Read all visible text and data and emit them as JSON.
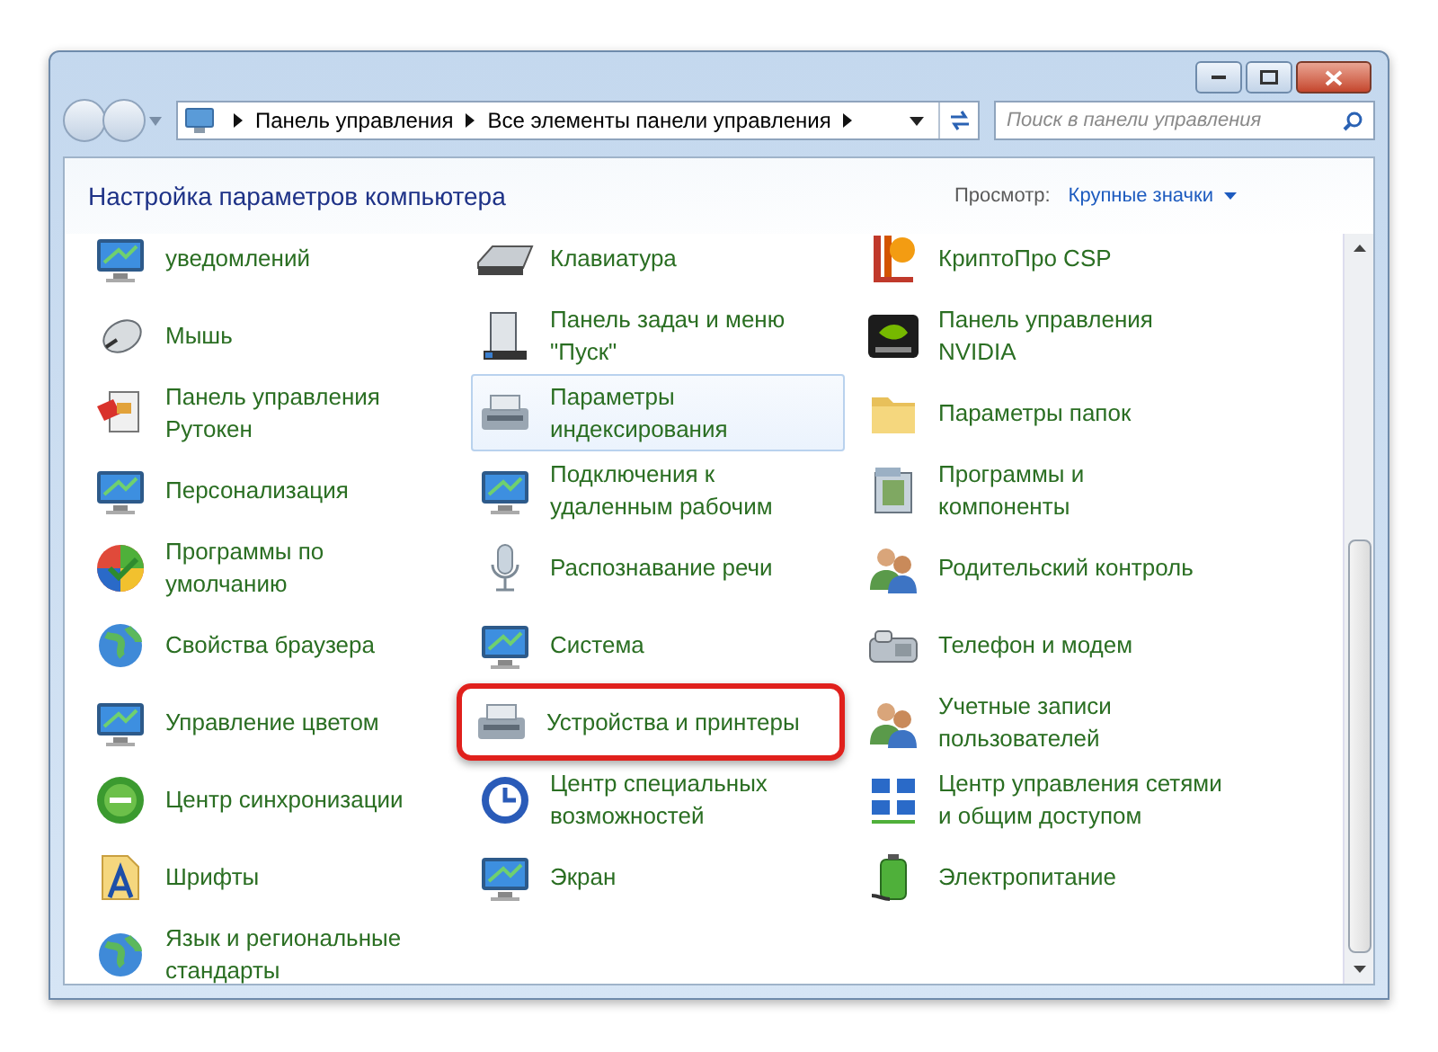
{
  "address_bar": {
    "path": [
      "Панель управления",
      "Все элементы панели управления"
    ],
    "search_placeholder": "Поиск в панели управления"
  },
  "header": {
    "title": "Настройка параметров компьютера",
    "view_label": "Просмотр:",
    "view_value": "Крупные значки"
  },
  "columns": [
    {
      "items": [
        {
          "lines": [
            "уведомлений"
          ],
          "hovered": false,
          "annotated": false
        },
        {
          "lines": [
            "Мышь"
          ],
          "hovered": false,
          "annotated": false
        },
        {
          "lines": [
            "Панель управления",
            "Рутокен"
          ],
          "hovered": false,
          "annotated": false
        },
        {
          "lines": [
            "Персонализация"
          ],
          "hovered": false,
          "annotated": false
        },
        {
          "lines": [
            "Программы по",
            "умолчанию"
          ],
          "hovered": false,
          "annotated": false
        },
        {
          "lines": [
            "Свойства браузера"
          ],
          "hovered": false,
          "annotated": false
        },
        {
          "lines": [
            "Управление цветом"
          ],
          "hovered": false,
          "annotated": false
        },
        {
          "lines": [
            "Центр синхронизации"
          ],
          "hovered": false,
          "annotated": false
        },
        {
          "lines": [
            "Шрифты"
          ],
          "hovered": false,
          "annotated": false
        },
        {
          "lines": [
            "Язык и региональные",
            "стандарты"
          ],
          "hovered": false,
          "annotated": false
        }
      ]
    },
    {
      "items": [
        {
          "lines": [
            "Клавиатура"
          ],
          "hovered": false,
          "annotated": false
        },
        {
          "lines": [
            "Панель задач и меню",
            "\"Пуск\""
          ],
          "hovered": false,
          "annotated": false
        },
        {
          "lines": [
            "Параметры",
            "индексирования"
          ],
          "hovered": true,
          "annotated": false
        },
        {
          "lines": [
            "Подключения к",
            "удаленным рабочим"
          ],
          "hovered": false,
          "annotated": false
        },
        {
          "lines": [
            "Распознавание речи"
          ],
          "hovered": false,
          "annotated": false
        },
        {
          "lines": [
            "Система"
          ],
          "hovered": false,
          "annotated": false
        },
        {
          "lines": [
            "Устройства и принтеры"
          ],
          "hovered": false,
          "annotated": true
        },
        {
          "lines": [
            "Центр специальных",
            "возможностей"
          ],
          "hovered": false,
          "annotated": false
        },
        {
          "lines": [
            "Экран"
          ],
          "hovered": false,
          "annotated": false
        }
      ]
    },
    {
      "items": [
        {
          "lines": [
            "КриптоПро CSP"
          ],
          "hovered": false,
          "annotated": false
        },
        {
          "lines": [
            "Панель управления",
            "NVIDIA"
          ],
          "hovered": false,
          "annotated": false
        },
        {
          "lines": [
            "Параметры папок"
          ],
          "hovered": false,
          "annotated": false
        },
        {
          "lines": [
            "Программы и",
            "компоненты"
          ],
          "hovered": false,
          "annotated": false
        },
        {
          "lines": [
            "Родительский контроль"
          ],
          "hovered": false,
          "annotated": false
        },
        {
          "lines": [
            "Телефон и модем"
          ],
          "hovered": false,
          "annotated": false
        },
        {
          "lines": [
            "Учетные записи",
            "пользователей"
          ],
          "hovered": false,
          "annotated": false
        },
        {
          "lines": [
            "Центр управления сетями",
            "и общим доступом"
          ],
          "hovered": false,
          "annotated": false
        },
        {
          "lines": [
            "Электропитание"
          ],
          "hovered": false,
          "annotated": false
        }
      ]
    }
  ]
}
